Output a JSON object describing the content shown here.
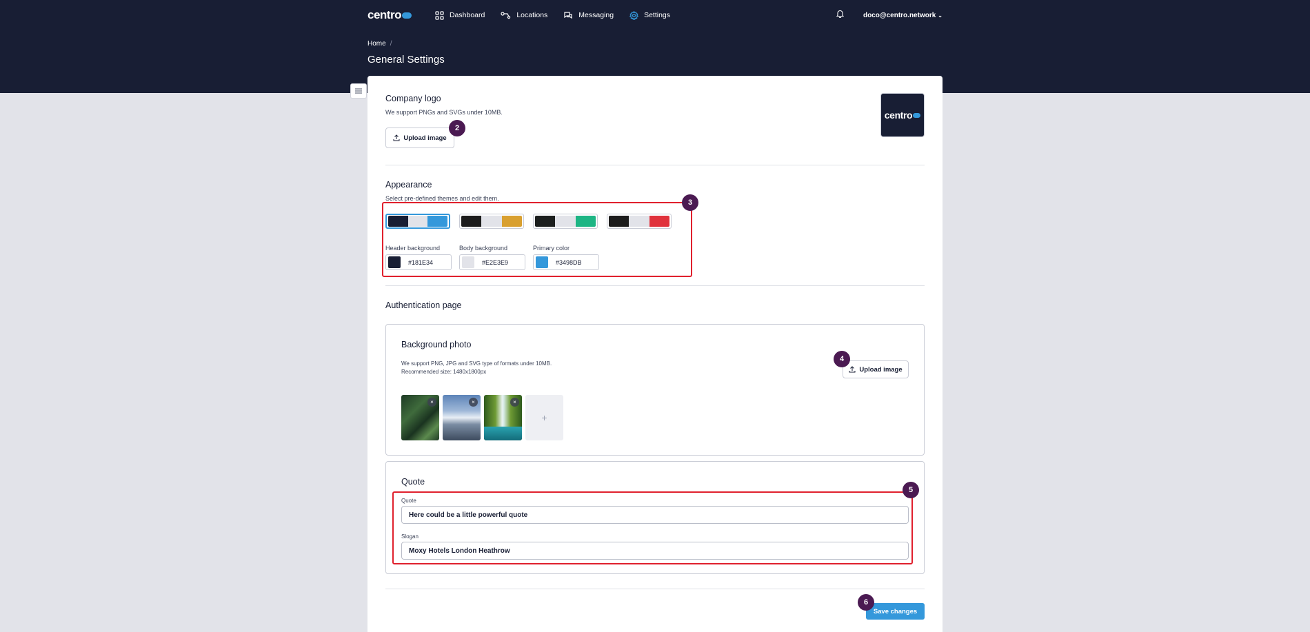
{
  "brand": {
    "logo_text": "centro",
    "primary_color": "#3498DB",
    "header_bg": "#181E34",
    "body_bg": "#E2E3E9"
  },
  "nav": {
    "items": [
      {
        "label": "Dashboard",
        "icon": "dashboard-grid-icon"
      },
      {
        "label": "Locations",
        "icon": "locations-icon"
      },
      {
        "label": "Messaging",
        "icon": "messaging-icon"
      },
      {
        "label": "Settings",
        "icon": "gear-icon",
        "active": true
      }
    ],
    "user_email": "doco@centro.network"
  },
  "breadcrumb": {
    "home": "Home",
    "separator": "/"
  },
  "page_title": "General Settings",
  "company_logo": {
    "title": "Company logo",
    "description": "We support PNGs and SVGs under 10MB.",
    "upload_label": "Upload image",
    "preview_text": "centro"
  },
  "appearance": {
    "title": "Appearance",
    "description": "Select pre-defined themes and edit them.",
    "themes": [
      {
        "colors": [
          "#181E34",
          "#E2E3E9",
          "#3498DB"
        ],
        "selected": true
      },
      {
        "colors": [
          "#1C1C1C",
          "#E2E3E9",
          "#D9A030"
        ],
        "selected": false
      },
      {
        "colors": [
          "#1C1F1E",
          "#E2E3E9",
          "#1DB584"
        ],
        "selected": false
      },
      {
        "colors": [
          "#1C1C1C",
          "#E2E3E9",
          "#E0323C"
        ],
        "selected": false
      }
    ],
    "header_bg_label": "Header background",
    "header_bg_value": "#181E34",
    "body_bg_label": "Body background",
    "body_bg_value": "#E2E3E9",
    "primary_label": "Primary color",
    "primary_value": "#3498DB"
  },
  "auth_page": {
    "title": "Authentication page",
    "background": {
      "title": "Background photo",
      "desc_line1": "We support PNG, JPG and SVG type of formats under 10MB.",
      "desc_line2": "Recommended size: 1480x1800px",
      "upload_label": "Upload image",
      "remove_symbol": "×",
      "add_symbol": "+"
    },
    "quote": {
      "title": "Quote",
      "quote_label": "Quote",
      "quote_value": "Here could be a little powerful quote",
      "slogan_label": "Slogan",
      "slogan_value": "Moxy Hotels London Heathrow"
    }
  },
  "save_label": "Save changes",
  "annotations": [
    "2",
    "3",
    "4",
    "5",
    "6"
  ]
}
